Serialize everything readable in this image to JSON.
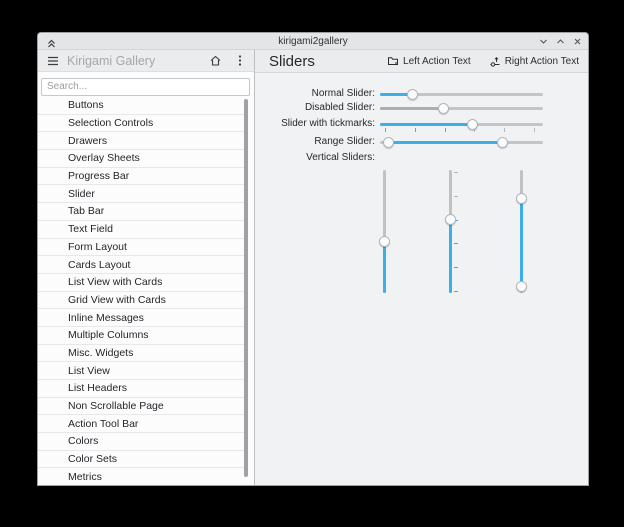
{
  "colors": {
    "accent": "#3daee9",
    "disabled_fill": "#acaeb0",
    "groove": "#c3c5c6"
  },
  "titlebar": {
    "title": "kirigami2gallery"
  },
  "sidebar": {
    "app_title": "Kirigami Gallery",
    "search_placeholder": "Search...",
    "items": [
      "Buttons",
      "Selection Controls",
      "Drawers",
      "Overlay Sheets",
      "Progress Bar",
      "Slider",
      "Tab Bar",
      "Text Field",
      "Form Layout",
      "Cards Layout",
      "List View with Cards",
      "Grid View with Cards",
      "Inline Messages",
      "Multiple Columns",
      "Misc. Widgets",
      "List View",
      "List Headers",
      "Non Scrollable Page",
      "Action Tool Bar",
      "Colors",
      "Color Sets",
      "Metrics"
    ]
  },
  "main": {
    "title": "Sliders",
    "toolbar": {
      "left_label": "Left Action Text",
      "right_label": "Right Action Text"
    },
    "sliders": {
      "normal": {
        "label": "Normal Slider:",
        "value_pct": 20
      },
      "disabled": {
        "label": "Disabled Slider:",
        "value_pct": 39
      },
      "tickmarks": {
        "label": "Slider with tickmarks:",
        "value_pct": 57,
        "ticks": 6
      },
      "range": {
        "label": "Range Slider:",
        "low_pct": 5,
        "high_pct": 75
      },
      "vertical_label": "Vertical Sliders:",
      "vertical": [
        {
          "value_pct": 58
        },
        {
          "value_pct": 40,
          "ticks": 6
        },
        {
          "low_pct": 23,
          "high_pct": 95
        }
      ]
    }
  }
}
